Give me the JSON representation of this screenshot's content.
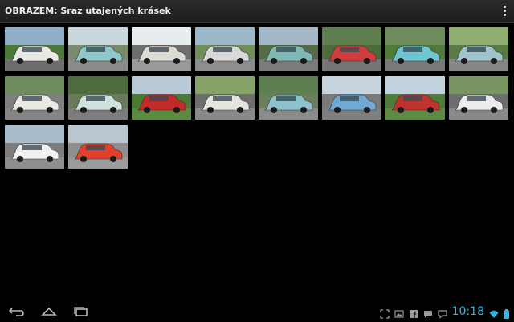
{
  "header": {
    "title": "OBRAZEM: Sraz utajených krásek"
  },
  "gallery": {
    "photos": [
      {
        "sky": "#8fb0c8",
        "ground": "#4d7a3a",
        "car": "#e8e8e4",
        "road": "#6d6d6d"
      },
      {
        "sky": "#c9d6de",
        "ground": "#7a8a6a",
        "car": "#8fc8c8",
        "road": "#8b8b8b"
      },
      {
        "sky": "#e7ecef",
        "ground": "#6e6e6e",
        "car": "#dcdcd4",
        "road": "#9a9a9a"
      },
      {
        "sky": "#9ab7c8",
        "ground": "#6f8e5a",
        "car": "#d8d8d8",
        "road": "#8e8e8e"
      },
      {
        "sky": "#a4b8c8",
        "ground": "#546b45",
        "car": "#7fb9b5",
        "road": "#7b7b7b"
      },
      {
        "sky": "#5f7f4f",
        "ground": "#4d6b3a",
        "car": "#d23c3c",
        "road": "#767676"
      },
      {
        "sky": "#6f8c5c",
        "ground": "#4f7a3a",
        "car": "#6ec6d0",
        "road": "#7a7a7a"
      },
      {
        "sky": "#8fae6f",
        "ground": "#5a7b44",
        "car": "#9fc4cc",
        "road": "#868686"
      },
      {
        "sky": "#6f8d5c",
        "ground": "#7f7f7f",
        "car": "#e9e9e4",
        "road": "#858585"
      },
      {
        "sky": "#4e6b3e",
        "ground": "#6a7a5a",
        "car": "#cfe2e0",
        "road": "#7d7d7d"
      },
      {
        "sky": "#b9c9d6",
        "ground": "#4c7a34",
        "car": "#c52a2a",
        "road": "#5c8a40"
      },
      {
        "sky": "#86a46a",
        "ground": "#6e6e6e",
        "car": "#e5e5df",
        "road": "#8a8a8a"
      },
      {
        "sky": "#5e7f50",
        "ground": "#6c7f5c",
        "car": "#8cc2cc",
        "road": "#8b8b8b"
      },
      {
        "sky": "#c7d4de",
        "ground": "#7a7a7a",
        "car": "#6fa9d6",
        "road": "#7f7f7f"
      },
      {
        "sky": "#c2d2dc",
        "ground": "#4e7d3a",
        "car": "#c0322e",
        "road": "#5f8a44"
      },
      {
        "sky": "#7a9463",
        "ground": "#6d6d6d",
        "car": "#ececec",
        "road": "#8a8a8a"
      },
      {
        "sky": "#a9bccb",
        "ground": "#7d7d7d",
        "car": "#f1f1f1",
        "road": "#8e8e8e"
      },
      {
        "sky": "#b9c6cf",
        "ground": "#8f8f8f",
        "car": "#e2402a",
        "road": "#9b9b9b"
      }
    ]
  },
  "status": {
    "time": "10:18",
    "accent": "#33b5e5"
  }
}
